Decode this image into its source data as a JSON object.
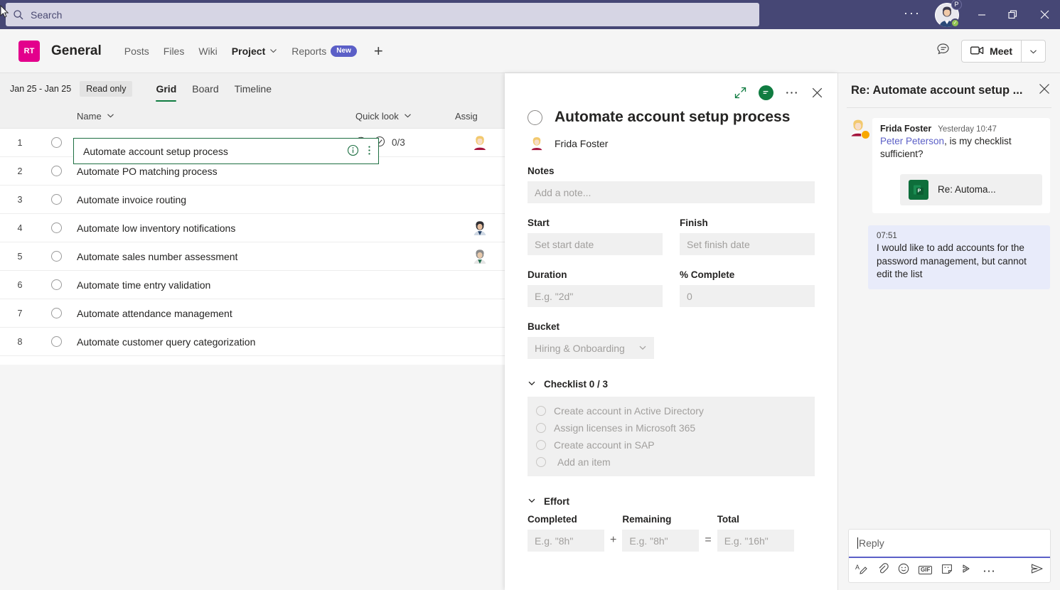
{
  "titlebar": {
    "search_placeholder": "Search",
    "search_icon": "search-icon",
    "more_label": "···",
    "avatar_badge": "P",
    "minimize_label": "Minimize",
    "restore_label": "Restore",
    "close_label": "Close",
    "bar_color": "#464775",
    "search_bg": "#d6d5e4"
  },
  "channel_header": {
    "team_initials": "RT",
    "team_color": "#e3008c",
    "title": "General",
    "tabs": [
      {
        "label": "Posts",
        "active": false,
        "chevron": false,
        "badge": null
      },
      {
        "label": "Files",
        "active": false,
        "chevron": false,
        "badge": null
      },
      {
        "label": "Wiki",
        "active": false,
        "chevron": false,
        "badge": null
      },
      {
        "label": "Project",
        "active": true,
        "chevron": true,
        "badge": null
      },
      {
        "label": "Reports",
        "active": false,
        "chevron": false,
        "badge": "New"
      }
    ],
    "add_tab_label": "+",
    "meet_label": "Meet",
    "badge_color": "#5b5fc7"
  },
  "project_toolbar": {
    "date_range": "Jan 25 - Jan 25",
    "read_only": "Read only",
    "views": [
      {
        "label": "Grid",
        "active": true
      },
      {
        "label": "Board",
        "active": false
      },
      {
        "label": "Timeline",
        "active": false
      }
    ],
    "accent_color": "#107c41"
  },
  "grid": {
    "columns": {
      "name": "Name",
      "quick_look": "Quick look",
      "assigned": "Assig"
    },
    "selected_row_index": 1,
    "rows": [
      {
        "num": "1",
        "name": "Automate account setup process",
        "quick_look": "0/3",
        "has_comment": true,
        "assignee": "female-blonde",
        "selected": true
      },
      {
        "num": "2",
        "name": "Automate PO matching process",
        "quick_look": "",
        "has_comment": false,
        "assignee": null,
        "selected": false
      },
      {
        "num": "3",
        "name": "Automate invoice routing",
        "quick_look": "",
        "has_comment": false,
        "assignee": null,
        "selected": false
      },
      {
        "num": "4",
        "name": "Automate low inventory notifications",
        "quick_look": "",
        "has_comment": false,
        "assignee": "male-dark",
        "selected": false
      },
      {
        "num": "5",
        "name": "Automate sales number assessment",
        "quick_look": "",
        "has_comment": false,
        "assignee": "male-grey",
        "selected": false
      },
      {
        "num": "6",
        "name": "Automate time entry validation",
        "quick_look": "",
        "has_comment": false,
        "assignee": null,
        "selected": false
      },
      {
        "num": "7",
        "name": "Automate attendance management",
        "quick_look": "",
        "has_comment": false,
        "assignee": null,
        "selected": false
      },
      {
        "num": "8",
        "name": "Automate customer query categorization",
        "quick_look": "",
        "has_comment": false,
        "assignee": null,
        "selected": false
      }
    ]
  },
  "detail": {
    "title": "Automate account setup process",
    "assignee": "Frida Foster",
    "notes_label": "Notes",
    "notes_placeholder": "Add a note...",
    "fields": {
      "start_label": "Start",
      "start_placeholder": "Set start date",
      "finish_label": "Finish",
      "finish_placeholder": "Set finish date",
      "duration_label": "Duration",
      "duration_placeholder": "E.g. \"2d\"",
      "percent_label": "% Complete",
      "percent_value": "0",
      "bucket_label": "Bucket",
      "bucket_value": "Hiring & Onboarding"
    },
    "checklist_header": "Checklist 0 / 3",
    "checklist": [
      {
        "label": "Create account in Active Directory",
        "checked": false
      },
      {
        "label": "Assign licenses in Microsoft 365",
        "checked": false
      },
      {
        "label": "Create account in SAP",
        "checked": false
      },
      {
        "label": "Add an item",
        "checked": false
      }
    ],
    "effort_header": "Effort",
    "effort": {
      "completed_label": "Completed",
      "completed_placeholder": "E.g. \"8h\"",
      "plus": "+",
      "remaining_label": "Remaining",
      "remaining_placeholder": "E.g. \"8h\"",
      "equals": "=",
      "total_label": "Total",
      "total_placeholder": "E.g. \"16h\""
    }
  },
  "chat": {
    "title": "Re: Automate account setup ...",
    "messages": [
      {
        "type": "incoming",
        "author": "Frida Foster",
        "time": "Yesterday 10:47",
        "mention": "Peter Peterson",
        "text": ", is my checklist sufficient?",
        "attachment": "Re: Automa..."
      },
      {
        "type": "outgoing",
        "time": "07:51",
        "text": "I would like to add accounts for the password management, but cannot edit the list"
      }
    ],
    "reply_placeholder": "Reply",
    "toolbar_icons": [
      "format-icon",
      "attach-icon",
      "emoji-icon",
      "gif-icon",
      "sticker-icon",
      "loop-icon",
      "more-icon",
      "send-icon"
    ],
    "outgoing_bg": "#e8ebfa"
  }
}
